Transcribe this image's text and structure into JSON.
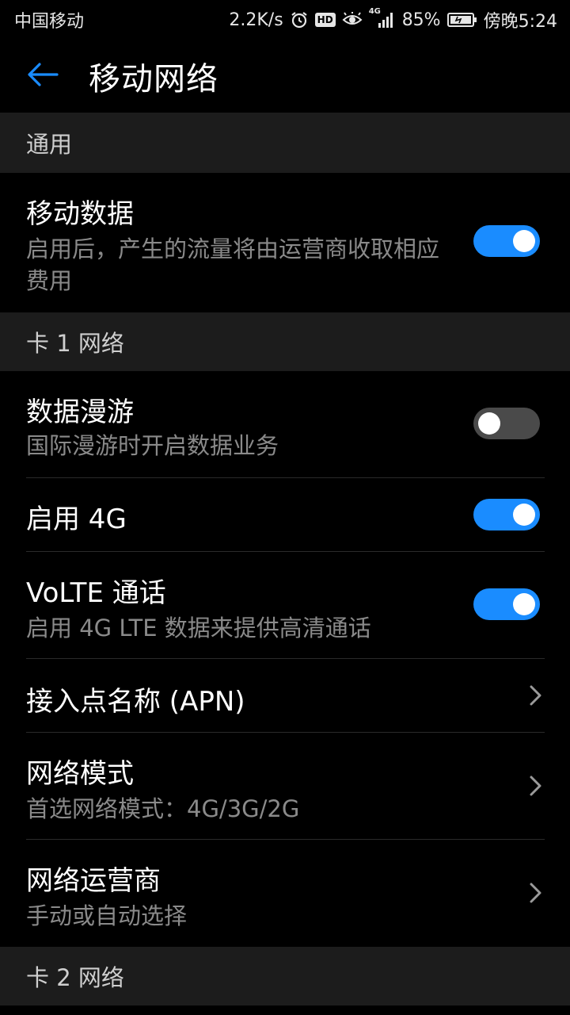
{
  "status_bar": {
    "carrier": "中国移动",
    "net_speed": "2.2K/s",
    "hd_badge": "HD",
    "signal_label": "4G",
    "battery": "85%",
    "time": "傍晚5:24"
  },
  "app_bar": {
    "title": "移动网络"
  },
  "sections": {
    "general": {
      "header": "通用"
    },
    "sim1": {
      "header": "卡 1 网络"
    },
    "sim2": {
      "header": "卡 2 网络"
    }
  },
  "settings": {
    "mobile_data": {
      "title": "移动数据",
      "subtitle": "启用后，产生的流量将由运营商收取相应费用",
      "enabled": true
    },
    "data_roaming": {
      "title": "数据漫游",
      "subtitle": "国际漫游时开启数据业务",
      "enabled": false
    },
    "enable_4g": {
      "title": "启用 4G",
      "enabled": true
    },
    "volte": {
      "title": "VoLTE 通话",
      "subtitle": "启用 4G LTE 数据来提供高清通话",
      "enabled": true
    },
    "apn": {
      "title": "接入点名称 (APN)"
    },
    "network_mode": {
      "title": "网络模式",
      "subtitle": "首选网络模式：4G/3G/2G"
    },
    "network_operator": {
      "title": "网络运营商",
      "subtitle": "手动或自动选择"
    }
  },
  "colors": {
    "accent": "#1a8cff",
    "background": "#000000",
    "section_bg": "#1c1c1c",
    "switch_off": "#4a4a4a",
    "subtitle": "#8a8a8a"
  },
  "icons": {
    "back": "arrow-left-icon",
    "alarm": "alarm-icon",
    "eye": "eye-comfort-icon",
    "signal": "signal-icon",
    "battery": "battery-icon",
    "chevron": "chevron-right-icon"
  }
}
